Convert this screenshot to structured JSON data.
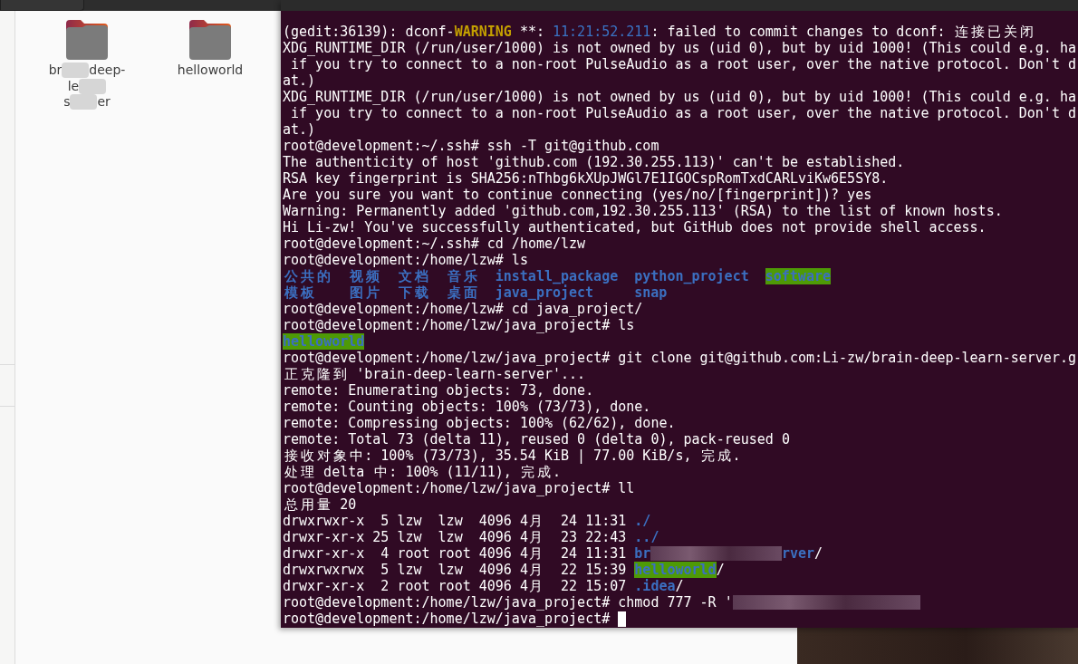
{
  "file_manager": {
    "items": [
      {
        "label_lines": [
          {
            "parts": [
              "br",
              "deep-"
            ]
          },
          {
            "parts": [
              "le"
            ]
          },
          {
            "parts": [
              "s",
              "er"
            ]
          }
        ],
        "redacted": true
      },
      {
        "label_lines": [
          {
            "parts": [
              "helloworld"
            ]
          }
        ],
        "redacted": false
      }
    ]
  },
  "terminal": {
    "lines": [
      {
        "segments": [
          {
            "kind": "plain",
            "text": "(gedit:36139): dconf-"
          },
          {
            "kind": "warning",
            "text": "WARNING"
          },
          {
            "kind": "plain",
            "text": " **: "
          },
          {
            "kind": "time",
            "text": "11:21:52.211"
          },
          {
            "kind": "plain",
            "text": ": failed to commit changes to dconf: 连接已关闭"
          }
        ]
      },
      {
        "segments": [
          {
            "kind": "plain",
            "text": "XDG_RUNTIME_DIR (/run/user/1000) is not owned by us (uid 0), but by uid 1000! (This could e.g. ha"
          }
        ]
      },
      {
        "segments": [
          {
            "kind": "plain",
            "text": " if you try to connect to a non-root PulseAudio as a root user, over the native protocol. Don't d"
          }
        ]
      },
      {
        "segments": [
          {
            "kind": "plain",
            "text": "at.)"
          }
        ]
      },
      {
        "segments": [
          {
            "kind": "plain",
            "text": "XDG_RUNTIME_DIR (/run/user/1000) is not owned by us (uid 0), but by uid 1000! (This could e.g. ha"
          }
        ]
      },
      {
        "segments": [
          {
            "kind": "plain",
            "text": " if you try to connect to a non-root PulseAudio as a root user, over the native protocol. Don't d"
          }
        ]
      },
      {
        "segments": [
          {
            "kind": "plain",
            "text": "at.)"
          }
        ]
      },
      {
        "segments": [
          {
            "kind": "plain",
            "text": "root@development:~/.ssh# ssh -T git@github.com"
          }
        ]
      },
      {
        "segments": [
          {
            "kind": "plain",
            "text": "The authenticity of host 'github.com (192.30.255.113)' can't be established."
          }
        ]
      },
      {
        "segments": [
          {
            "kind": "plain",
            "text": "RSA key fingerprint is SHA256:nThbg6kXUpJWGl7E1IGOCspRomTxdCARLviKw6E5SY8."
          }
        ]
      },
      {
        "segments": [
          {
            "kind": "plain",
            "text": "Are you sure you want to continue connecting (yes/no/[fingerprint])? yes"
          }
        ]
      },
      {
        "segments": [
          {
            "kind": "plain",
            "text": "Warning: Permanently added 'github.com,192.30.255.113' (RSA) to the list of known hosts."
          }
        ]
      },
      {
        "segments": [
          {
            "kind": "plain",
            "text": "Hi Li-zw! You've successfully authenticated, but GitHub does not provide shell access."
          }
        ]
      },
      {
        "segments": [
          {
            "kind": "plain",
            "text": "root@development:~/.ssh# cd /home/lzw"
          }
        ]
      },
      {
        "segments": [
          {
            "kind": "plain",
            "text": "root@development:/home/lzw# ls"
          }
        ]
      },
      {
        "ls_entries": [
          {
            "kind": "dir",
            "text": "公共的"
          },
          {
            "kind": "dir",
            "text": "视频"
          },
          {
            "kind": "dir",
            "text": "文档"
          },
          {
            "kind": "dir",
            "text": "音乐"
          },
          {
            "kind": "dir",
            "text": "install_package"
          },
          {
            "kind": "dir",
            "text": "python_project"
          },
          {
            "kind": "dir-writable",
            "text": "software"
          }
        ]
      },
      {
        "ls_entries": [
          {
            "kind": "dir",
            "text": "模板"
          },
          {
            "kind": "dir",
            "text": "图片"
          },
          {
            "kind": "dir",
            "text": "下载"
          },
          {
            "kind": "dir",
            "text": "桌面"
          },
          {
            "kind": "dir",
            "text": "java_project"
          },
          {
            "kind": "dir",
            "text": "snap"
          }
        ]
      },
      {
        "segments": [
          {
            "kind": "plain",
            "text": "root@development:/home/lzw# cd java_project/"
          }
        ]
      },
      {
        "segments": [
          {
            "kind": "plain",
            "text": "root@development:/home/lzw/java_project# ls"
          }
        ]
      },
      {
        "segments": [
          {
            "kind": "dir-writable",
            "text": "helloworld"
          }
        ]
      },
      {
        "segments": [
          {
            "kind": "plain",
            "text": "root@development:/home/lzw/java_project# git clone git@github.com:Li-zw/brain-deep-learn-server.g"
          }
        ]
      },
      {
        "segments": [
          {
            "kind": "plain",
            "text": "正克隆到 'brain-deep-learn-server'..."
          }
        ]
      },
      {
        "segments": [
          {
            "kind": "plain",
            "text": "remote: Enumerating objects: 73, done."
          }
        ]
      },
      {
        "segments": [
          {
            "kind": "plain",
            "text": "remote: Counting objects: 100% (73/73), done."
          }
        ]
      },
      {
        "segments": [
          {
            "kind": "plain",
            "text": "remote: Compressing objects: 100% (62/62), done."
          }
        ]
      },
      {
        "segments": [
          {
            "kind": "plain",
            "text": "remote: Total 73 (delta 11), reused 0 (delta 0), pack-reused 0"
          }
        ]
      },
      {
        "segments": [
          {
            "kind": "plain",
            "text": "接收对象中: 100% (73/73), 35.54 KiB | 77.00 KiB/s, 完成."
          }
        ]
      },
      {
        "segments": [
          {
            "kind": "plain",
            "text": "处理 delta 中: 100% (11/11), 完成."
          }
        ]
      },
      {
        "segments": [
          {
            "kind": "plain",
            "text": "root@development:/home/lzw/java_project# ll"
          }
        ]
      },
      {
        "segments": [
          {
            "kind": "plain",
            "text": "总用量 20"
          }
        ]
      },
      {
        "segments": [
          {
            "kind": "plain",
            "text": "drwxrwxr-x  5 lzw  lzw  4096 4月  24 11:31 "
          },
          {
            "kind": "dir",
            "text": "./"
          }
        ]
      },
      {
        "segments": [
          {
            "kind": "plain",
            "text": "drwxr-xr-x 25 lzw  lzw  4096 4月  23 22:43 "
          },
          {
            "kind": "dir",
            "text": "../"
          }
        ]
      },
      {
        "segments": [
          {
            "kind": "plain",
            "text": "drwxr-xr-x  4 root root 4096 4月  24 11:31 "
          },
          {
            "kind": "dir",
            "text": "br"
          },
          {
            "kind": "redaction"
          },
          {
            "kind": "dir",
            "text": "rver"
          },
          {
            "kind": "plain",
            "text": "/"
          }
        ]
      },
      {
        "segments": [
          {
            "kind": "plain",
            "text": "drwxrwxrwx  5 lzw  lzw  4096 4月  22 15:39 "
          },
          {
            "kind": "dir-writable",
            "text": "helloworld"
          },
          {
            "kind": "plain",
            "text": "/"
          }
        ]
      },
      {
        "segments": [
          {
            "kind": "plain",
            "text": "drwxr-xr-x  2 root root 4096 4月  22 15:07 "
          },
          {
            "kind": "dir",
            "text": ".idea"
          },
          {
            "kind": "plain",
            "text": "/"
          }
        ]
      },
      {
        "segments": [
          {
            "kind": "plain",
            "text": "root@development:/home/lzw/java_project# chmod 777 -R '"
          },
          {
            "kind": "redaction"
          }
        ]
      },
      {
        "segments": [
          {
            "kind": "plain",
            "text": "root@development:/home/lzw/java_project# "
          },
          {
            "kind": "cursor"
          }
        ]
      }
    ]
  }
}
